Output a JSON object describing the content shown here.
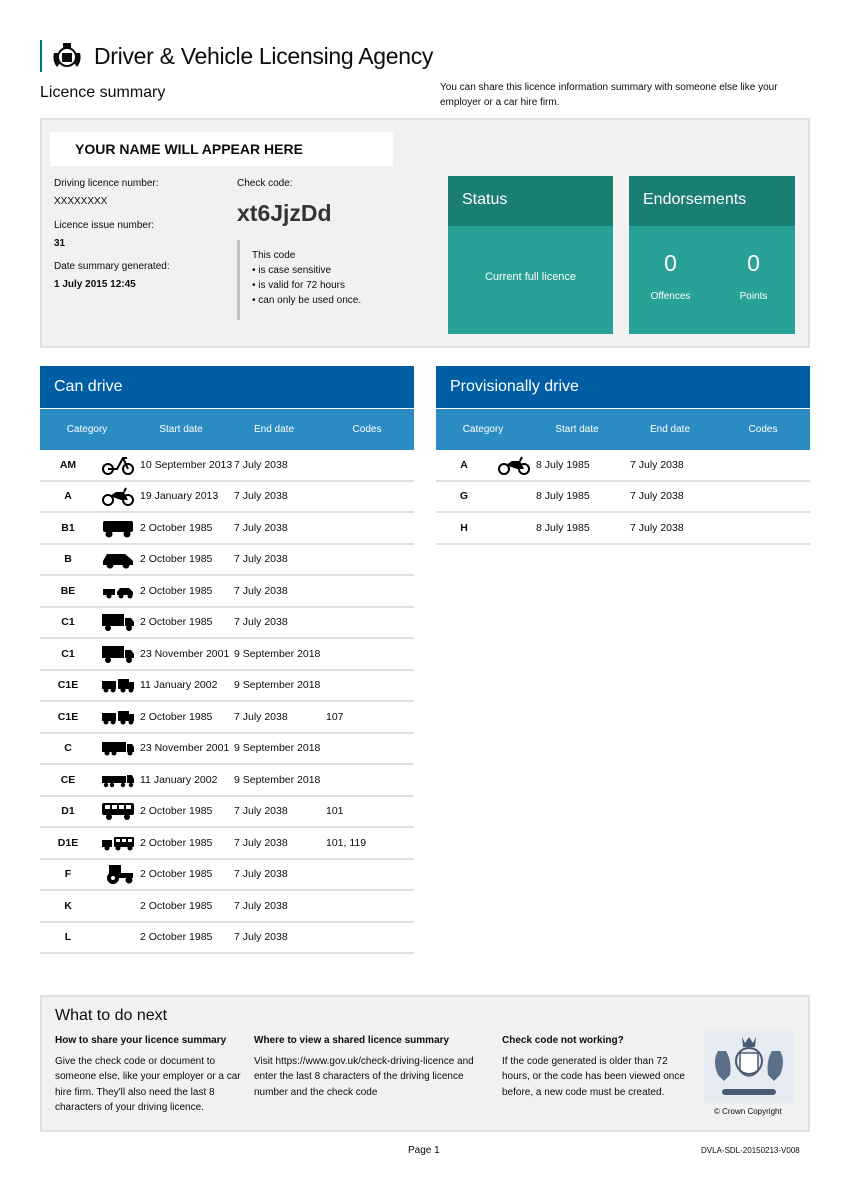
{
  "header": {
    "agency_name": "Driver & Vehicle Licensing Agency"
  },
  "summary": {
    "title": "Licence summary",
    "share_note": "You can share this licence information summary with someone else like your employer or a car hire firm.",
    "name_placeholder": "YOUR NAME WILL APPEAR HERE",
    "licence_number_label": "Driving licence number:",
    "licence_number": "XXXXXXXX",
    "issue_number_label": "Licence issue number:",
    "issue_number": "31",
    "date_generated_label": "Date summary generated:",
    "date_generated": "1 July 2015 12:45",
    "check_code_label": "Check code:",
    "check_code": "xt6JjzDd",
    "code_note_title": "This code",
    "code_note_items": [
      "is case sensitive",
      "is valid for 72 hours",
      "can only be used once."
    ]
  },
  "status": {
    "title": "Status",
    "value": "Current full licence"
  },
  "endorsements": {
    "title": "Endorsements",
    "offences_value": "0",
    "offences_label": "Offences",
    "points_value": "0",
    "points_label": "Points"
  },
  "can_drive": {
    "title": "Can drive",
    "headers": [
      "Category",
      "Start date",
      "End date",
      "Codes"
    ],
    "rows": [
      {
        "category": "AM",
        "icon": "moped-icon",
        "start": "10 September 2013",
        "end": "7 July 2038",
        "codes": ""
      },
      {
        "category": "A",
        "icon": "motorcycle-icon",
        "start": "19 January 2013",
        "end": "7 July 2038",
        "codes": ""
      },
      {
        "category": "B1",
        "icon": "quadricycle-icon",
        "start": "2 October 1985",
        "end": "7 July 2038",
        "codes": ""
      },
      {
        "category": "B",
        "icon": "car-icon",
        "start": "2 October 1985",
        "end": "7 July 2038",
        "codes": ""
      },
      {
        "category": "BE",
        "icon": "car-trailer-icon",
        "start": "2 October 1985",
        "end": "7 July 2038",
        "codes": ""
      },
      {
        "category": "C1",
        "icon": "medium-lorry-icon",
        "start": "2 October 1985",
        "end": "7 July 2038",
        "codes": ""
      },
      {
        "category": "C1",
        "icon": "medium-lorry-icon",
        "start": "23 November 2001",
        "end": "9 September 2018",
        "codes": ""
      },
      {
        "category": "C1E",
        "icon": "medium-lorry-trailer-icon",
        "start": "11 January 2002",
        "end": "9 September 2018",
        "codes": ""
      },
      {
        "category": "C1E",
        "icon": "medium-lorry-trailer-icon",
        "start": "2 October 1985",
        "end": "7 July 2038",
        "codes": "107"
      },
      {
        "category": "C",
        "icon": "lorry-icon",
        "start": "23 November 2001",
        "end": "9 September 2018",
        "codes": ""
      },
      {
        "category": "CE",
        "icon": "articulated-lorry-icon",
        "start": "11 January 2002",
        "end": "9 September 2018",
        "codes": ""
      },
      {
        "category": "D1",
        "icon": "minibus-icon",
        "start": "2 October 1985",
        "end": "7 July 2038",
        "codes": "101"
      },
      {
        "category": "D1E",
        "icon": "minibus-trailer-icon",
        "start": "2 October 1985",
        "end": "7 July 2038",
        "codes": "101, 119"
      },
      {
        "category": "F",
        "icon": "tractor-icon",
        "start": "2 October 1985",
        "end": "7 July 2038",
        "codes": ""
      },
      {
        "category": "K",
        "icon": "",
        "start": "2 October 1985",
        "end": "7 July 2038",
        "codes": ""
      },
      {
        "category": "L",
        "icon": "",
        "start": "2 October 1985",
        "end": "7 July 2038",
        "codes": ""
      }
    ]
  },
  "provisional": {
    "title": "Provisionally drive",
    "headers": [
      "Category",
      "Start date",
      "End date",
      "Codes"
    ],
    "rows": [
      {
        "category": "A",
        "icon": "motorcycle-icon",
        "start": "8 July 1985",
        "end": "7 July 2038",
        "codes": ""
      },
      {
        "category": "G",
        "icon": "",
        "start": "8 July 1985",
        "end": "7 July 2038",
        "codes": ""
      },
      {
        "category": "H",
        "icon": "",
        "start": "8 July 1985",
        "end": "7 July 2038",
        "codes": ""
      }
    ]
  },
  "next": {
    "title": "What to do next",
    "share_title": "How to share your licence summary",
    "share_text": "Give the check code or document to someone else, like your employer or a car hire firm. They'll also need the last 8 characters of your driving licence.",
    "view_title": "Where to view a shared licence summary",
    "view_text": "Visit https://www.gov.uk/check-driving-licence and enter the last 8 characters of the driving licence number and the check code",
    "notworking_title": "Check code not working?",
    "notworking_text": "If the code generated is older than 72 hours, or the code has been viewed once before, a new code must be created.",
    "copyright": "© Crown Copyright"
  },
  "footer": {
    "page": "Page 1",
    "doc_ref": "DVLA-SDL-20150213-V008"
  },
  "colors": {
    "teal": "#28a197",
    "teal_dark": "#1b7e73",
    "blue": "#005ea5",
    "blue_light": "#2b8cc4"
  }
}
